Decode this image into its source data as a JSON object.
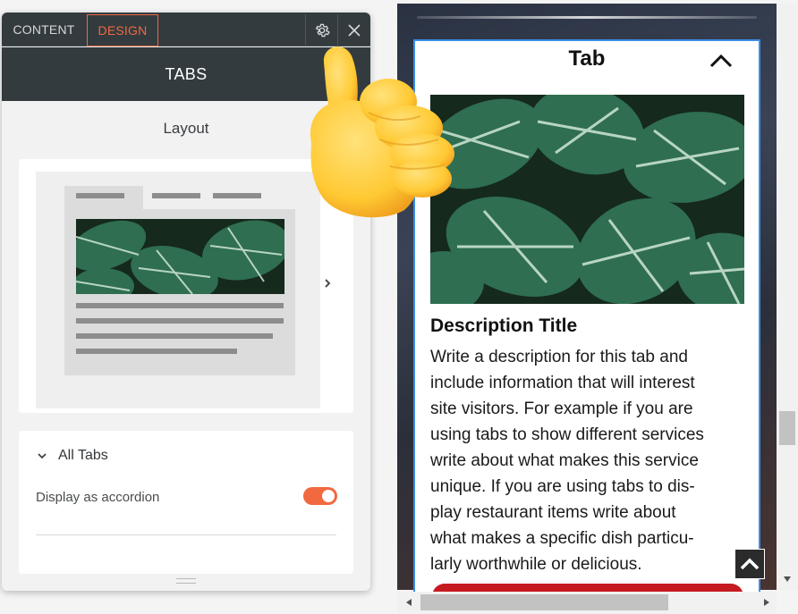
{
  "panel": {
    "tabs": [
      {
        "label": "CONTENT",
        "active": false
      },
      {
        "label": "DESIGN",
        "active": true
      }
    ],
    "gear_icon": "gear-icon",
    "close_icon": "close-icon",
    "title": "TABS",
    "layout_label": "Layout",
    "accordion": {
      "section_label": "All Tabs",
      "setting_label": "Display as accordion",
      "toggle_on": true
    },
    "accent_color": "#f2683f",
    "header_color": "#333b3f"
  },
  "preview": {
    "tab_title": "Tab",
    "description_title": "Description Title",
    "description_lines": [
      "Write a description for this tab and",
      "include information that will interest",
      "site visitors. For example if you are",
      "using tabs to show different services",
      "write about what makes this service",
      "unique. If you are using tabs to dis-",
      "play restaurant items write about",
      "what makes a specific dish particu-",
      "larly worthwhile or delicious."
    ],
    "button_color": "#c61a22",
    "selection_color": "#3b8ee6"
  }
}
